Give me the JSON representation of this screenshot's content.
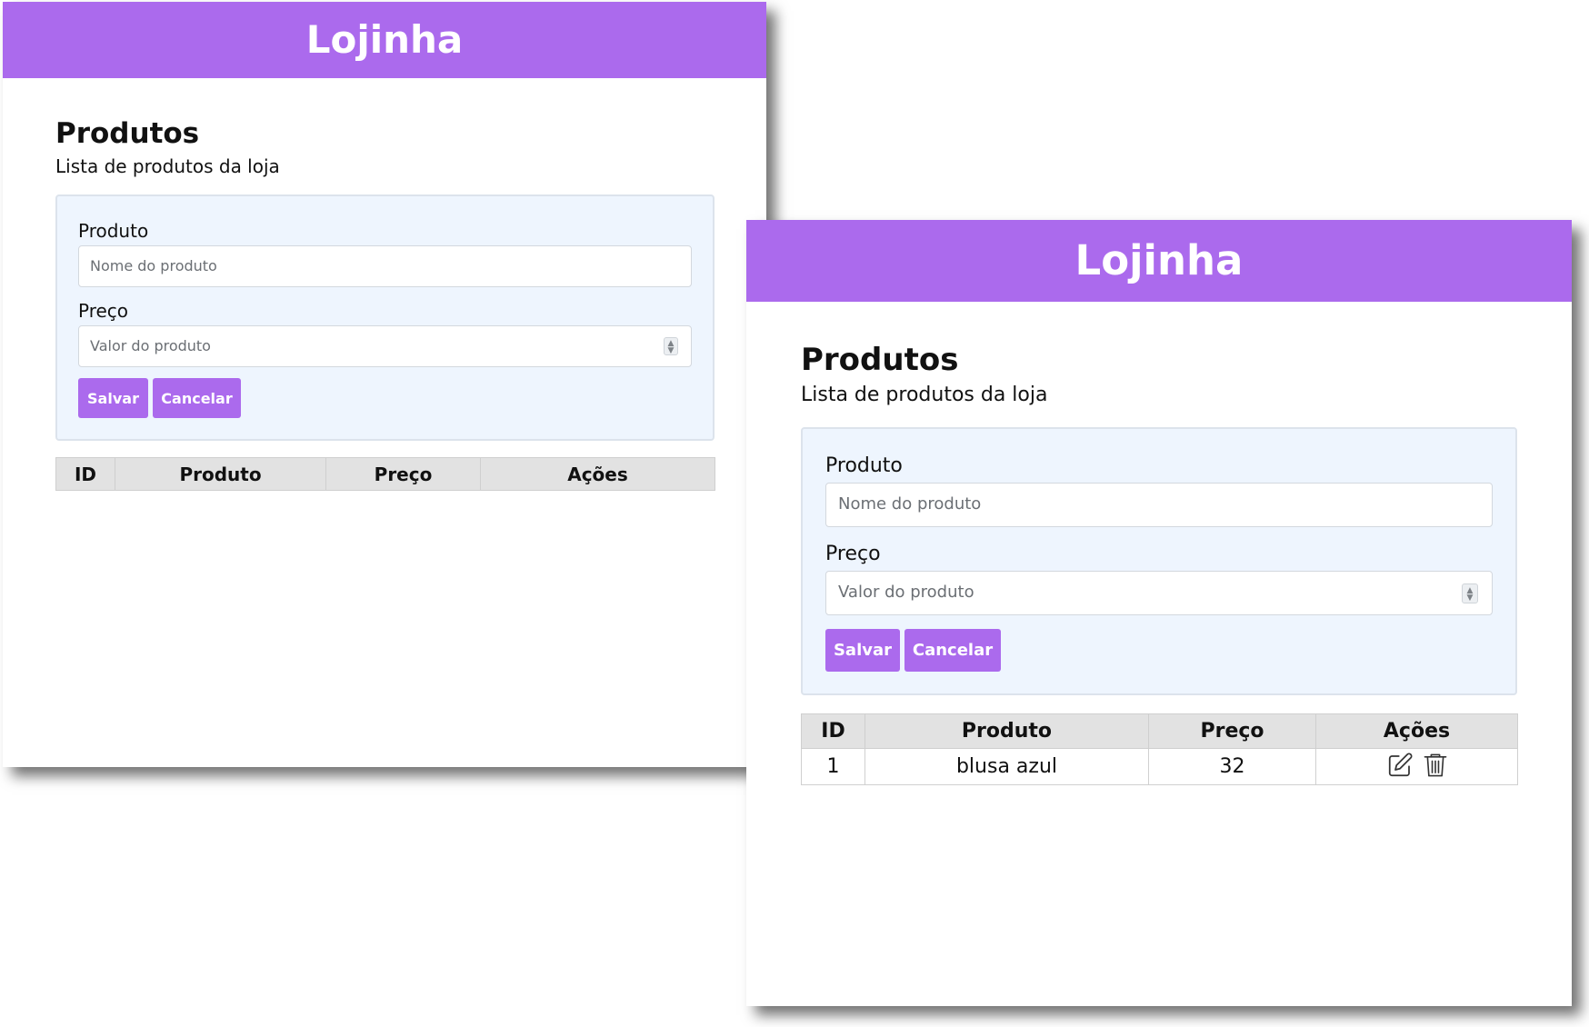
{
  "screens": [
    {
      "app_title": "Lojinha",
      "page": {
        "title": "Produtos",
        "subtitle": "Lista de produtos da loja"
      },
      "form": {
        "product_label": "Produto",
        "product_placeholder": "Nome do produto",
        "price_label": "Preço",
        "price_placeholder": "Valor do produto",
        "save_label": "Salvar",
        "cancel_label": "Cancelar"
      },
      "table": {
        "columns": [
          "ID",
          "Produto",
          "Preço",
          "Ações"
        ],
        "rows": []
      }
    },
    {
      "app_title": "Lojinha",
      "page": {
        "title": "Produtos",
        "subtitle": "Lista de produtos da loja"
      },
      "form": {
        "product_label": "Produto",
        "product_placeholder": "Nome do produto",
        "price_label": "Preço",
        "price_placeholder": "Valor do produto",
        "save_label": "Salvar",
        "cancel_label": "Cancelar"
      },
      "table": {
        "columns": [
          "ID",
          "Produto",
          "Preço",
          "Ações"
        ],
        "rows": [
          {
            "id": "1",
            "produto": "blusa azul",
            "preco": "32",
            "actions": [
              "edit-icon",
              "trash-icon"
            ]
          }
        ]
      }
    }
  ],
  "colors": {
    "accent": "#ab6aed",
    "form_background": "#eef5fe",
    "table_header_background": "#e2e2e2",
    "text": "#111111"
  }
}
